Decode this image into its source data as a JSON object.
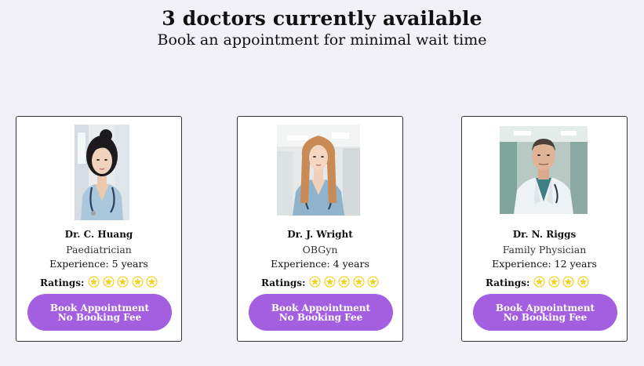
{
  "header": {
    "title": "3 doctors currently available",
    "subtitle": "Book an appointment for minimal wait time"
  },
  "colors": {
    "button": "#a45ee0",
    "star": "#f5d020",
    "background": "#f2f1f7"
  },
  "doctors": [
    {
      "name": "Dr. C. Huang",
      "specialty": "Paediatrician",
      "experience": "Experience: 5 years",
      "ratings_label": "Ratings:",
      "rating": 5,
      "button_line1": "Book Appointment",
      "button_line2": "No Booking Fee"
    },
    {
      "name": "Dr. J. Wright",
      "specialty": "OBGyn",
      "experience": "Experience: 4 years",
      "ratings_label": "Ratings:",
      "rating": 5,
      "button_line1": "Book Appointment",
      "button_line2": "No Booking Fee"
    },
    {
      "name": "Dr. N. Riggs",
      "specialty": "Family Physician",
      "experience": "Experience: 12 years",
      "ratings_label": "Ratings:",
      "rating": 4,
      "button_line1": "Book Appointment",
      "button_line2": "No Booking Fee"
    }
  ]
}
